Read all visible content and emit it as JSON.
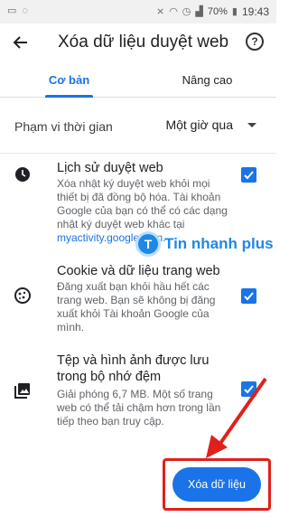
{
  "status_bar": {
    "battery": "70%",
    "time": "19:43"
  },
  "app_bar": {
    "title": "Xóa dữ liệu duyệt web",
    "help_icon": "?"
  },
  "tabs": [
    {
      "label": "Cơ bản",
      "selected": true
    },
    {
      "label": "Nâng cao",
      "selected": false
    }
  ],
  "time_range": {
    "label": "Phạm vi thời gian",
    "value": "Một giờ qua"
  },
  "options": {
    "history": {
      "title": "Lịch sử duyệt web",
      "description": "Xóa nhật ký duyệt web khỏi mọi thiết bị đã đồng bộ hóa. Tài khoản Google của bạn có thể có các dạng nhật ký duyệt web khác tại",
      "link": "myactivity.google.com.",
      "checked": true
    },
    "cookies": {
      "title": "Cookie và dữ liệu trang web",
      "description": "Đăng xuất bạn khỏi hầu hết các trang web. Bạn sẽ không bị đăng xuất khỏi Tài khoản Google của mình.",
      "checked": true
    },
    "cache": {
      "title": "Tệp và hình ảnh được lưu trong bộ nhớ đệm",
      "description": "Giải phóng 6,7 MB. Một số trang web có thể tải chậm hơn trong lần tiếp theo bạn truy cập.",
      "checked": true
    }
  },
  "watermark": {
    "logo_letter": "T",
    "text": "Tin nhanh plus"
  },
  "clear_button": {
    "label": "Xóa dữ liệu"
  },
  "colors": {
    "accent": "#1a73e8",
    "annotation": "#e0211b"
  }
}
